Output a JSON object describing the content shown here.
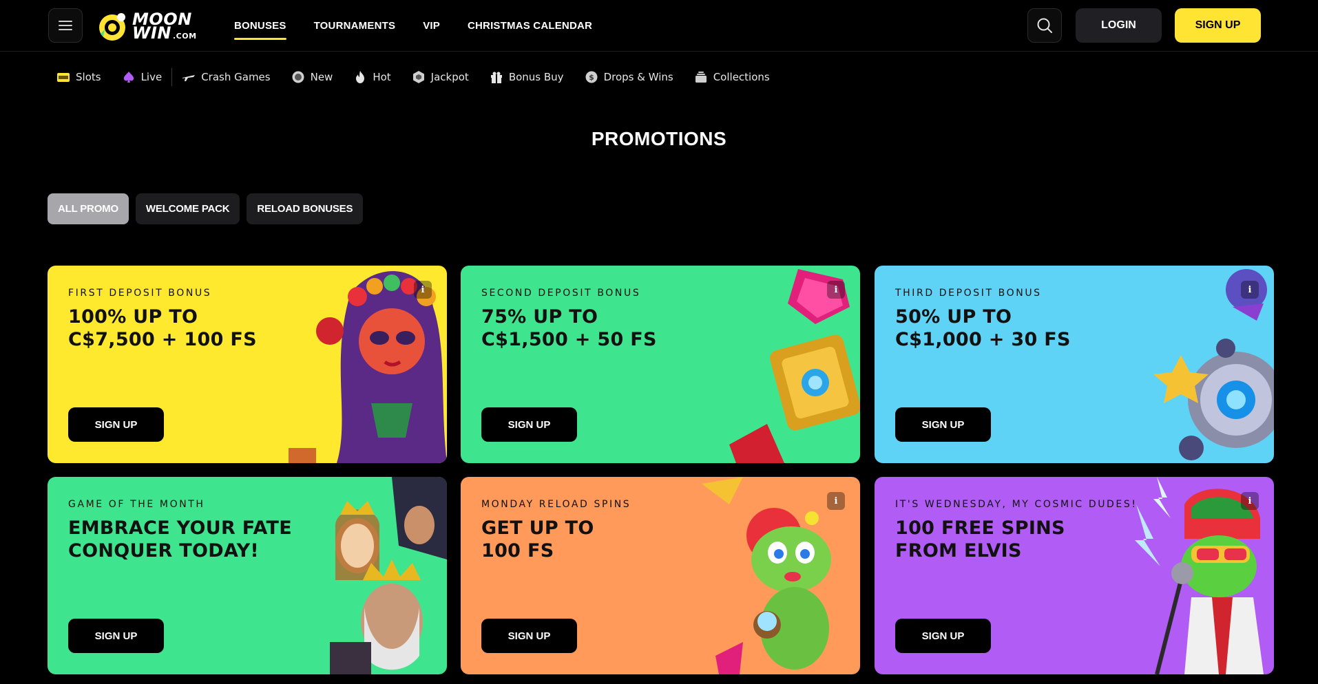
{
  "header": {
    "logo": {
      "line1": "MOON",
      "line2": "WIN",
      "suffix": ".COM"
    },
    "nav": [
      {
        "label": "BONUSES",
        "active": true
      },
      {
        "label": "TOURNAMENTS",
        "active": false
      },
      {
        "label": "VIP",
        "active": false
      },
      {
        "label": "CHRISTMAS CALENDAR",
        "active": false
      }
    ],
    "login_label": "LOGIN",
    "signup_label": "SIGN UP"
  },
  "categories": [
    {
      "label": "Slots",
      "icon": "slot-machine-icon"
    },
    {
      "label": "Live",
      "icon": "spade-icon"
    },
    {
      "label": "Crash Games",
      "icon": "plane-icon"
    },
    {
      "label": "New",
      "icon": "new-badge-icon"
    },
    {
      "label": "Hot",
      "icon": "flame-icon"
    },
    {
      "label": "Jackpot",
      "icon": "hexagon-gem-icon"
    },
    {
      "label": "Bonus Buy",
      "icon": "gift-icon"
    },
    {
      "label": "Drops & Wins",
      "icon": "coin-icon"
    },
    {
      "label": "Collections",
      "icon": "stack-icon"
    }
  ],
  "page_title": "PROMOTIONS",
  "filters": [
    {
      "label": "ALL PROMO",
      "active": true
    },
    {
      "label": "WELCOME PACK",
      "active": false
    },
    {
      "label": "RELOAD BONUSES",
      "active": false
    }
  ],
  "cards": [
    {
      "kicker": "FIRST DEPOSIT BONUS",
      "title_line1": "100% UP TO",
      "title_line2": "C$7,500 + 100 FS",
      "button": "SIGN UP",
      "bg": "#ffe92e"
    },
    {
      "kicker": "SECOND DEPOSIT BONUS",
      "title_line1": "75% UP TO",
      "title_line2": "C$1,500 + 50 FS",
      "button": "SIGN UP",
      "bg": "#3ee58e"
    },
    {
      "kicker": "THIRD DEPOSIT BONUS",
      "title_line1": "50% UP TO",
      "title_line2": "C$1,000 + 30 FS",
      "button": "SIGN UP",
      "bg": "#5fd3f5"
    },
    {
      "kicker": "GAME OF THE MONTH",
      "title_line1": "EMBRACE YOUR FATE",
      "title_line2": "CONQUER TODAY!",
      "button": "SIGN UP",
      "bg": "#3ee58e"
    },
    {
      "kicker": "MONDAY RELOAD SPINS",
      "title_line1": "GET UP TO",
      "title_line2": "100 FS",
      "button": "SIGN UP",
      "bg": "#ff9a5a"
    },
    {
      "kicker": "IT'S WEDNESDAY, MY COSMIC DUDES!",
      "title_line1": "100 FREE SPINS",
      "title_line2": "FROM ELVIS",
      "button": "SIGN UP",
      "bg": "#b05cf5"
    }
  ],
  "info_label": "i"
}
